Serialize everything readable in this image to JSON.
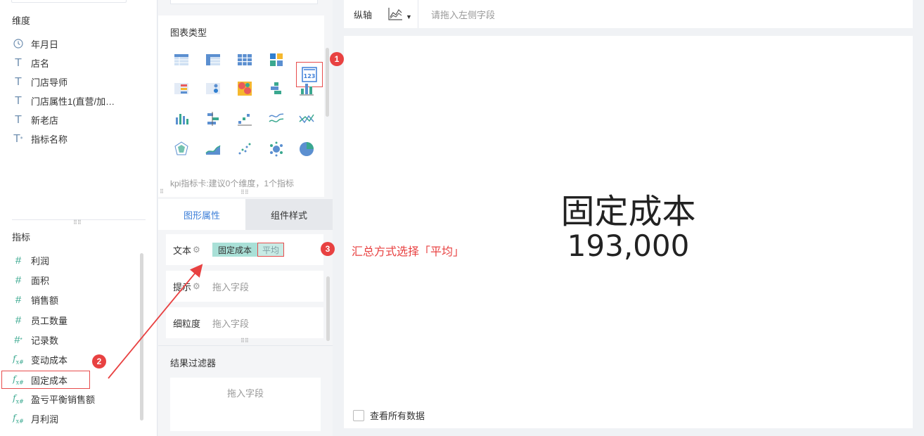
{
  "left_panel": {
    "dimension_title": "维度",
    "dimensions": [
      {
        "label": "年月日",
        "icon": "clock-icon"
      },
      {
        "label": "店名",
        "icon": "text-field-icon"
      },
      {
        "label": "门店导师",
        "icon": "text-field-icon"
      },
      {
        "label": "门店属性1(直营/加…",
        "icon": "text-field-icon"
      },
      {
        "label": "新老店",
        "icon": "text-field-icon"
      },
      {
        "label": "指标名称",
        "icon": "text-field-icon"
      }
    ],
    "metric_title": "指标",
    "metrics": [
      {
        "label": "利润",
        "icon": "hash-icon"
      },
      {
        "label": "面积",
        "icon": "hash-icon"
      },
      {
        "label": "销售额",
        "icon": "hash-icon"
      },
      {
        "label": "员工数量",
        "icon": "hash-icon"
      },
      {
        "label": "记录数",
        "icon": "hash-icon"
      },
      {
        "label": "变动成本",
        "icon": "formula-icon"
      },
      {
        "label": "固定成本",
        "icon": "formula-icon"
      },
      {
        "label": "盈亏平衡销售额",
        "icon": "formula-icon"
      },
      {
        "label": "月利润",
        "icon": "formula-icon"
      }
    ]
  },
  "middle_panel": {
    "chart_type_title": "图表类型",
    "chart_type_hint": "kpi指标卡:建议0个维度，1个指标",
    "tabs": [
      {
        "label": "图形属性",
        "active": true
      },
      {
        "label": "组件样式",
        "active": false
      }
    ],
    "properties": {
      "text_label": "文本",
      "text_field": "固定成本",
      "text_agg": "平均",
      "tip_label": "提示",
      "tip_placeholder": "拖入字段",
      "granularity_label": "细粒度",
      "granularity_placeholder": "拖入字段"
    },
    "filter_title": "结果过滤器",
    "filter_placeholder": "拖入字段"
  },
  "axis_bar": {
    "label": "纵轴",
    "placeholder": "请拖入左侧字段"
  },
  "kpi": {
    "title": "固定成本",
    "value": "193,000"
  },
  "view_all_label": "查看所有数据",
  "annotations": {
    "badge1": "1",
    "badge2": "2",
    "badge3": "3",
    "note3": "汇总方式选择「平均」"
  },
  "colors": {
    "accent": "#3d7fd8",
    "annotation": "#e84141",
    "field_pill": "#a9e0d7",
    "metric_icon": "#3aa88f"
  }
}
